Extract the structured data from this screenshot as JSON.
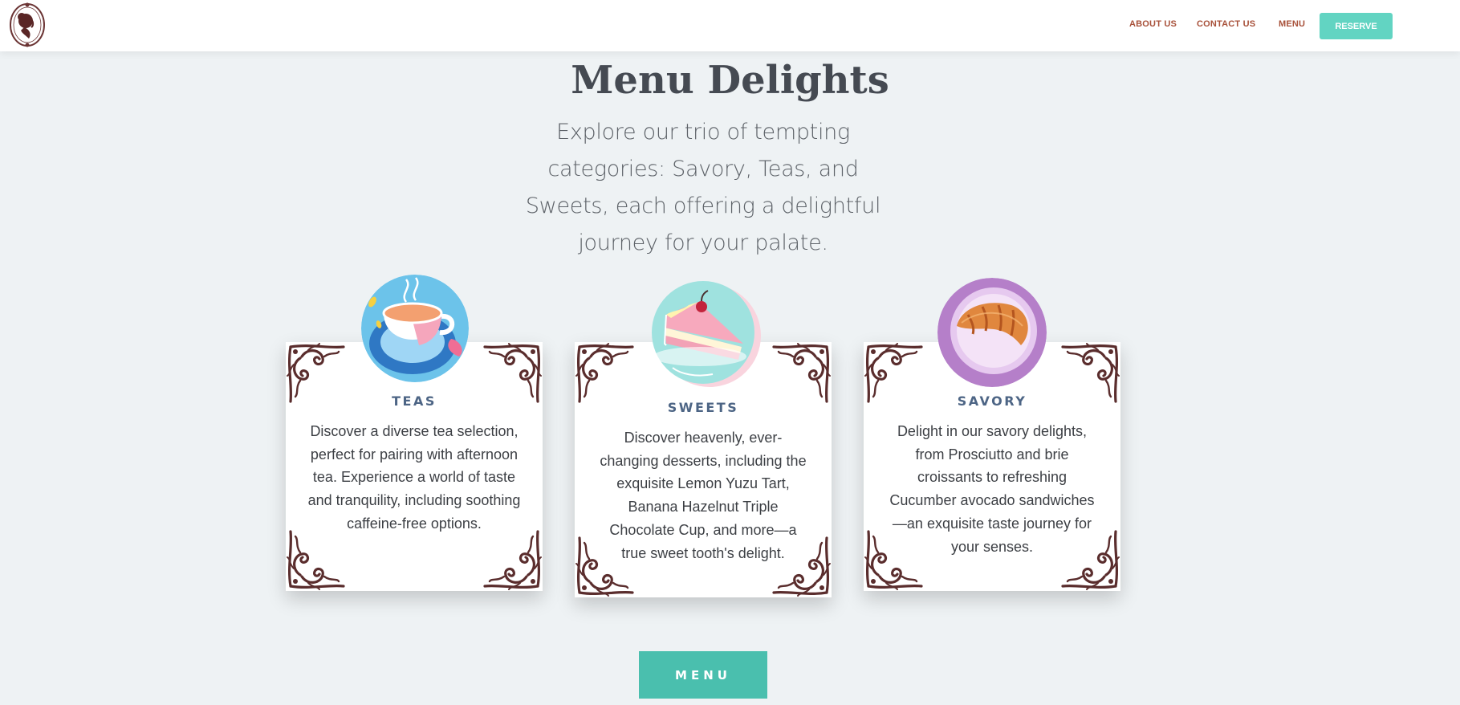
{
  "header": {
    "nav": [
      {
        "label": "ABOUT US"
      },
      {
        "label": "CONTACT US"
      },
      {
        "label": "MENU"
      }
    ],
    "reserve_label": "RESERVE",
    "logo_icon": "lady-silhouette-logo-icon"
  },
  "hero": {
    "title": "Menu Delights",
    "subtitle": "Explore our trio of tempting categories: Savory, Teas, and Sweets, each offering a delightful journey for your palate."
  },
  "cards": [
    {
      "title": "TEAS",
      "text": "Discover a diverse tea selection, perfect for pairing with afternoon tea. Experience a world of taste and tranquility, including soothing caffeine-free options.",
      "icon": "teacup-icon"
    },
    {
      "title": "SWEETS",
      "text": "Discover heavenly, ever-changing desserts, including the exquisite Lemon Yuzu Tart, Banana Hazelnut Triple Chocolate Cup, and more—a true sweet tooth's delight.",
      "icon": "cake-slice-icon"
    },
    {
      "title": "SAVORY",
      "text": "Delight in our savory delights, from Prosciutto and brie croissants to refreshing Cucumber avocado sandwiches—an exquisite taste journey for your senses.",
      "icon": "croissant-icon"
    }
  ],
  "menu_button": "MENU",
  "colors": {
    "background": "#eef2f4",
    "accent": "#4abfae",
    "reserve": "#62d4c2",
    "nav_text": "#a8513a",
    "card_title": "#4d6585",
    "ornament": "#5a2d2d"
  }
}
